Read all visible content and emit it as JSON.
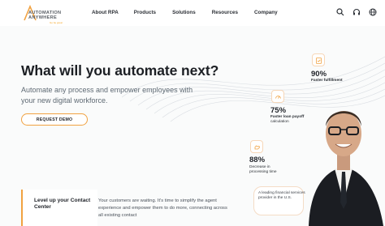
{
  "brand": {
    "name_line1": "AUTOMATION",
    "name_line2": "ANYWHERE",
    "tagline": "Go be great",
    "accent_color": "#f1a241"
  },
  "nav": {
    "items": [
      "About RPA",
      "Products",
      "Solutions",
      "Resources",
      "Company"
    ],
    "icons": [
      "search-icon",
      "headset-icon",
      "globe-icon"
    ]
  },
  "hero": {
    "headline": "What will you automate next?",
    "subhead": "Automate any process and empower employees with your new digital workforce.",
    "cta_label": "REQUEST DEMO"
  },
  "stats": [
    {
      "value": "90%",
      "label_bold": "Faster fulfillment",
      "label_rest": "",
      "icon": "clipboard-icon"
    },
    {
      "value": "75%",
      "label_bold": "Faster loan payoff",
      "label_rest": "calculation",
      "icon": "gauge-icon"
    },
    {
      "value": "88%",
      "label_bold": "",
      "label_rest": "Decrease in processing time",
      "icon": "hand-icon"
    }
  ],
  "cards": {
    "left_title": "Level up your Contact Center",
    "body": "Your customers are waiting. It's time to simplify the agent experience and empower them to do more, connecting across all existing contact",
    "speech": "A leading financial services provider in the U.S."
  }
}
